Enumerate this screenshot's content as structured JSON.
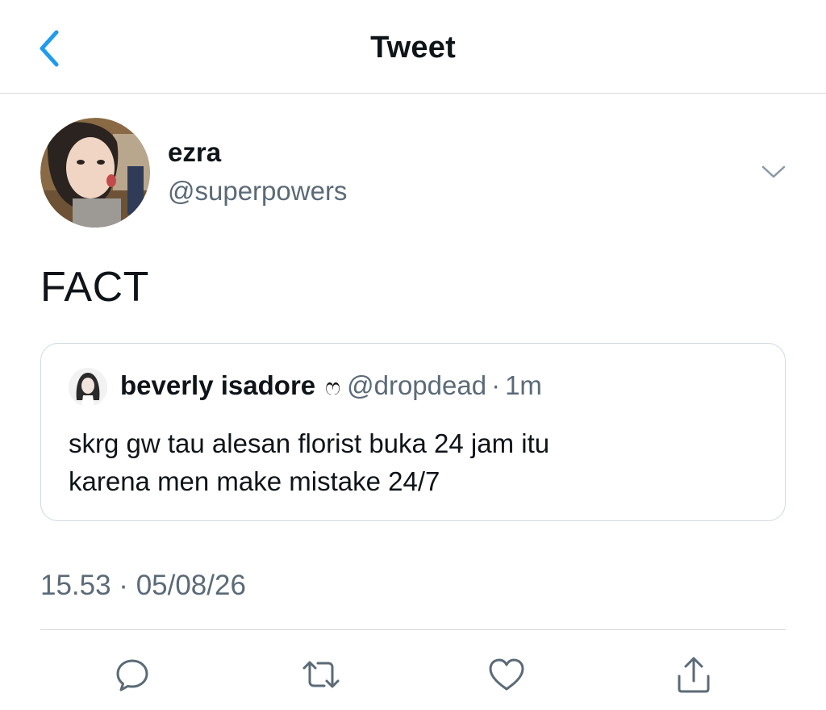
{
  "header": {
    "title": "Tweet",
    "back_icon": "chevron-left-icon"
  },
  "tweet": {
    "author_name": "ezra",
    "author_handle": "@superpowers",
    "text": "FACT",
    "timestamp": "15.53 · 05/08/26",
    "more_icon": "chevron-down-icon"
  },
  "quoted_tweet": {
    "author_name": "beverly isadore",
    "emoji": "ෆ",
    "author_handle": "@dropdead",
    "separator": "·",
    "time": "1m",
    "text_line1": "skrg gw tau alesan florist buka 24 jam itu",
    "text_line2": "karena men make mistake 24/7"
  },
  "actions": [
    "reply-icon",
    "retweet-icon",
    "like-icon",
    "share-icon"
  ],
  "colors": {
    "accent": "#1d9bf0",
    "secondary_text": "#5b6a77",
    "divider": "#d5d9dc",
    "icon": "#5b6a77"
  }
}
